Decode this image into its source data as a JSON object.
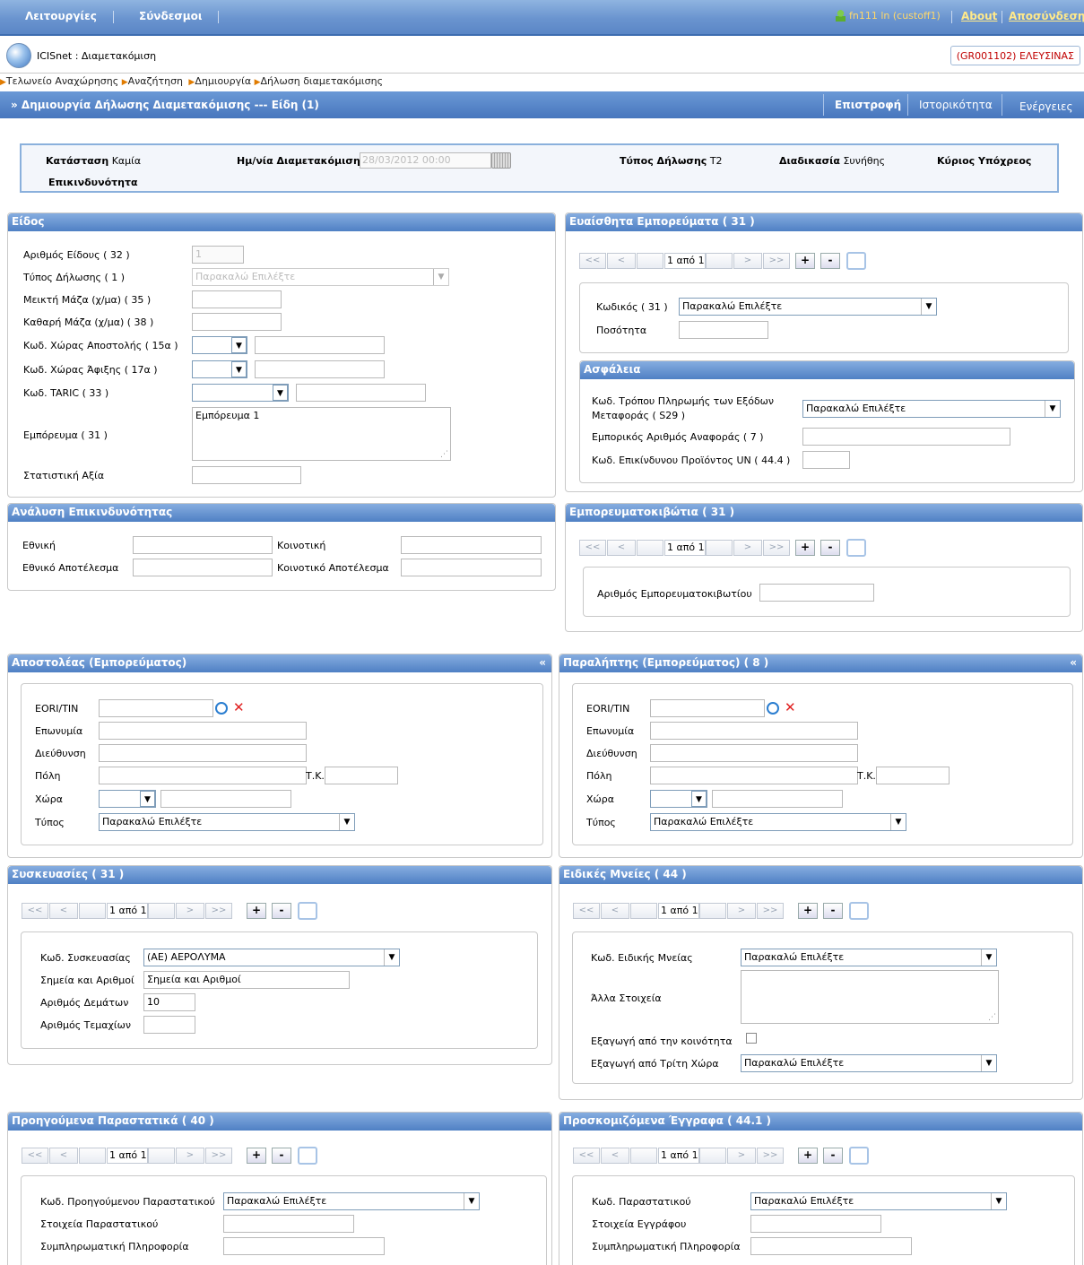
{
  "topbar": {
    "menu1": "Λειτουργίες",
    "menu2": "Σύνδεσμοι",
    "user": "fn111 ln (custoff1)",
    "about": "About",
    "logout": "Αποσύνδεση"
  },
  "app": {
    "title": "ICISnet : Διαμετακόμιση",
    "office": "(GR001102) ΕΛΕΥΣΙΝΑΣ"
  },
  "breadcrumb": [
    "Τελωνείο Αναχώρησης",
    "Αναζήτηση",
    "Δημιουργία",
    "Δήλωση διαμετακόμισης"
  ],
  "titlebar": {
    "title": "» Δημιουργία Δήλωσης Διαμετακόμισης --- Είδη (1)",
    "back": "Επιστροφή",
    "history": "Ιστορικότητα",
    "actions": "Ενέργειες"
  },
  "status": {
    "state_label": "Κατάσταση",
    "state_value": "Καμία",
    "date_label": "Ημ/νία Διαμετακόμισης",
    "date_value": "28/03/2012 00:00",
    "type_label": "Τύπος Δήλωσης",
    "type_value": "T2",
    "proc_label": "Διαδικασία",
    "proc_value": "Συνήθης",
    "principal_label": "Κύριος Υπόχρεος",
    "risk_label": "Επικινδυνότητα"
  },
  "item": {
    "title": "Είδος",
    "item_no_label": "Αριθμός Είδους ( 32 )",
    "item_no_value": "1",
    "decl_type_label": "Τύπος Δήλωσης ( 1 )",
    "decl_type_value": "Παρακαλώ Επιλέξτε",
    "gross_label": "Μεικτή Μάζα (χ/μα) ( 35 )",
    "net_label": "Καθαρή Μάζα (χ/μα) ( 38 )",
    "dispatch_label": "Κωδ. Χώρας Αποστολής ( 15α )",
    "dest_label": "Κωδ. Χώρας Άφιξης ( 17α )",
    "taric_label": "Κωδ. TARIC ( 33 )",
    "goods_label": "Εμπόρευμα ( 31 )",
    "goods_value": "Εμπόρευμα 1",
    "stat_label": "Στατιστική Αξία"
  },
  "sensitive": {
    "title": "Ευαίσθητα Εμπορεύματα ( 31 )",
    "code_label": "Κωδικός ( 31 )",
    "code_value": "Παρακαλώ Επιλέξτε",
    "qty_label": "Ποσότητα"
  },
  "safety": {
    "title": "Ασφάλεια",
    "pay_label1": "Κωδ. Τρόπου Πληρωμής των Εξόδων",
    "pay_label2": "Μεταφοράς ( S29 )",
    "pay_value": "Παρακαλώ Επιλέξτε",
    "ref_label": "Εμπορικός Αριθμός Αναφοράς ( 7 )",
    "un_label": "Κωδ. Επικίνδυνου Προϊόντος UN ( 44.4 )"
  },
  "risk": {
    "title": "Ανάλυση Επικινδυνότητας",
    "nat_label": "Εθνική",
    "com_label": "Κοινοτική",
    "natres_label": "Εθνικό Αποτέλεσμα",
    "comres_label": "Κοινοτικό Αποτέλεσμα"
  },
  "containers": {
    "title": "Εμπορευματοκιβώτια ( 31 )",
    "no_label": "Αριθμός Εμπορευματοκιβωτίου"
  },
  "consignor": {
    "title": "Αποστολέας (Εμπορεύματος)"
  },
  "consignee": {
    "title": "Παραλήπτης (Εμπορεύματος) ( 8 )"
  },
  "party": {
    "eori": "EORI/TIN",
    "name": "Επωνυμία",
    "address": "Διεύθυνση",
    "city": "Πόλη",
    "zip": "Τ.Κ.",
    "country": "Χώρα",
    "type": "Τύπος",
    "type_value": "Παρακαλώ Επιλέξτε"
  },
  "packages": {
    "title": "Συσκευασίες ( 31 )",
    "kind_label": "Κωδ. Συσκευασίας",
    "kind_value": "(AE) ΑΕΡΟΛΥΜΑ",
    "marks_label": "Σημεία και Αριθμοί",
    "marks_value": "Σημεία και Αριθμοί",
    "pkg_label": "Αριθμός Δεμάτων",
    "pkg_value": "10",
    "pcs_label": "Αριθμός Τεμαχίων"
  },
  "special": {
    "title": "Ειδικές Μνείες ( 44 )",
    "code_label": "Κωδ. Ειδικής Μνείας",
    "code_value": "Παρακαλώ Επιλέξτε",
    "other_label": "Άλλα Στοιχεία",
    "export_ec_label": "Εξαγωγή από την κοινότητα",
    "export_tc_label": "Εξαγωγή από Τρίτη Χώρα",
    "export_tc_value": "Παρακαλώ Επιλέξτε"
  },
  "prevdocs": {
    "title": "Προηγούμενα Παραστατικά ( 40 )",
    "code_label": "Κωδ. Προηγούμενου Παραστατικού",
    "code_value": "Παρακαλώ Επιλέξτε",
    "data_label": "Στοιχεία Παραστατικού",
    "info_label": "Συμπληρωματική Πληροφορία"
  },
  "docs": {
    "title": "Προσκομιζόμενα Έγγραφα ( 44.1 )",
    "code_label": "Κωδ. Παραστατικού",
    "code_value": "Παρακαλώ Επιλέξτε",
    "data_label": "Στοιχεία Εγγράφου",
    "info_label": "Συμπληρωματική Πληροφορία"
  },
  "pager": {
    "first": "<<",
    "prev": "<",
    "page": "1 από 1",
    "next": ">",
    "last": ">>",
    "add": "+",
    "remove": "-"
  },
  "collapse": "«",
  "colors": {
    "header": "#4f80c4",
    "accent": "#6a94cf",
    "office": "#c00000"
  },
  "icons": [
    "globe-icon",
    "calendar-icon",
    "search-icon",
    "close-icon",
    "chevron-down-icon",
    "user-icon",
    "grid-icon"
  ]
}
